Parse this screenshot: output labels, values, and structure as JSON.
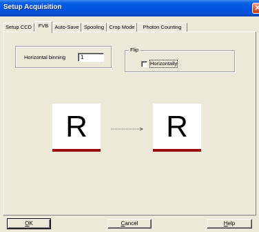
{
  "window": {
    "title": "Setup Acquisition",
    "close_glyph": "✕"
  },
  "tabs": [
    {
      "label": "Setup CCD",
      "active": false
    },
    {
      "label": "FVB",
      "active": true
    },
    {
      "label": "Auto-Save",
      "active": false
    },
    {
      "label": "Spooling",
      "active": false
    },
    {
      "label": "Crop Mode",
      "active": false
    },
    {
      "label": "Photon Counting",
      "active": false
    }
  ],
  "binning": {
    "label": "Horizontal binning",
    "value": "1"
  },
  "flip": {
    "title": "Flip",
    "horizontally_label": "Horizontally",
    "horizontally_checked": false
  },
  "preview": {
    "left_letter": "R",
    "right_letter": "R",
    "bar_color": "#9c0a0a"
  },
  "buttons": {
    "ok": {
      "mnemonic": "O",
      "rest": "K"
    },
    "cancel": {
      "mnemonic": "C",
      "rest": "ancel"
    },
    "help": {
      "mnemonic": "H",
      "rest": "elp"
    }
  }
}
